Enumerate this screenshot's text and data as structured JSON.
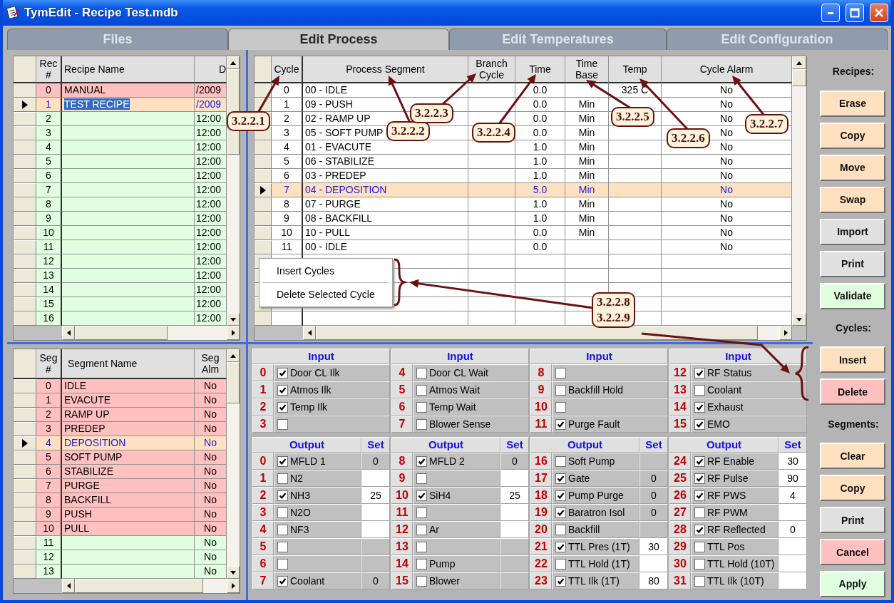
{
  "window": {
    "title": "TymEdit - Recipe Test.mdb"
  },
  "tabs": [
    {
      "label": "Files",
      "selected": false
    },
    {
      "label": "Edit Process",
      "selected": true
    },
    {
      "label": "Edit Temperatures",
      "selected": false
    },
    {
      "label": "Edit Configuration",
      "selected": false
    }
  ],
  "recipes": {
    "columns": [
      "Rec #",
      "Recipe Name",
      "D"
    ],
    "rows": [
      {
        "num": "0",
        "name": "MANUAL",
        "date": "/2009",
        "defined": true,
        "selected": false
      },
      {
        "num": "1",
        "name": "TEST RECIPE",
        "date": "/2009",
        "defined": true,
        "selected": true
      },
      {
        "num": "2",
        "date": "12:00",
        "defined": false,
        "selected": false
      },
      {
        "num": "3",
        "date": "12:00",
        "defined": false,
        "selected": false
      },
      {
        "num": "4",
        "date": "12:00",
        "defined": false,
        "selected": false
      },
      {
        "num": "5",
        "date": "12:00",
        "defined": false,
        "selected": false
      },
      {
        "num": "6",
        "date": "12:00",
        "defined": false,
        "selected": false
      },
      {
        "num": "7",
        "date": "12:00",
        "defined": false,
        "selected": false
      },
      {
        "num": "8",
        "date": "12:00",
        "defined": false,
        "selected": false
      },
      {
        "num": "9",
        "date": "12:00",
        "defined": false,
        "selected": false
      },
      {
        "num": "10",
        "date": "12:00",
        "defined": false,
        "selected": false
      },
      {
        "num": "11",
        "date": "12:00",
        "defined": false,
        "selected": false
      },
      {
        "num": "12",
        "date": "12:00",
        "defined": false,
        "selected": false
      },
      {
        "num": "13",
        "date": "12:00",
        "defined": false,
        "selected": false
      },
      {
        "num": "14",
        "date": "12:00",
        "defined": false,
        "selected": false
      },
      {
        "num": "15",
        "date": "12:00",
        "defined": false,
        "selected": false
      },
      {
        "num": "16",
        "date": "12:00",
        "defined": false,
        "selected": false
      }
    ]
  },
  "cycles": {
    "columns": [
      "Cycle",
      "Process Segment",
      "Branch Cycle",
      "Time",
      "Time Base",
      "Temp",
      "Cycle Alarm"
    ],
    "rows": [
      {
        "cycle": "0",
        "segment": "00 - IDLE",
        "time": "0.0",
        "temp": "325 C",
        "alarm": "No",
        "selected": false
      },
      {
        "cycle": "1",
        "segment": "09 - PUSH",
        "time": "0.0",
        "time_base": "Min",
        "alarm": "No",
        "selected": false
      },
      {
        "cycle": "2",
        "segment": "02 - RAMP UP",
        "time": "0.0",
        "time_base": "Min",
        "alarm": "No",
        "selected": false
      },
      {
        "cycle": "3",
        "segment": "05 - SOFT PUMP",
        "time": "0.0",
        "time_base": "Min",
        "alarm": "No",
        "selected": false
      },
      {
        "cycle": "4",
        "segment": "01 - EVACUTE",
        "time": "1.0",
        "time_base": "Min",
        "alarm": "No",
        "selected": false
      },
      {
        "cycle": "5",
        "segment": "06 - STABILIZE",
        "time": "1.0",
        "time_base": "Min",
        "alarm": "No",
        "selected": false
      },
      {
        "cycle": "6",
        "segment": "03 - PREDEP",
        "time": "1.0",
        "time_base": "Min",
        "alarm": "No",
        "selected": false
      },
      {
        "cycle": "7",
        "segment": "04 - DEPOSITION",
        "time": "5.0",
        "time_base": "Min",
        "alarm": "No",
        "selected": true
      },
      {
        "cycle": "8",
        "segment": "07 - PURGE",
        "time": "1.0",
        "time_base": "Min",
        "alarm": "No",
        "selected": false
      },
      {
        "cycle": "9",
        "segment": "08 - BACKFILL",
        "time": "1.0",
        "time_base": "Min",
        "alarm": "No",
        "selected": false
      },
      {
        "cycle": "10",
        "segment": "10 - PULL",
        "time": "0.0",
        "time_base": "Min",
        "alarm": "No",
        "selected": false
      },
      {
        "cycle": "11",
        "segment": "00 - IDLE",
        "time": "0.0",
        "alarm": "No",
        "selected": false
      }
    ]
  },
  "context_menu": {
    "items": [
      "Insert Cycles",
      "Delete Selected Cycle"
    ]
  },
  "segments": {
    "columns": [
      "Seg #",
      "Segment Name",
      "Seg Alm"
    ],
    "rows": [
      {
        "num": "0",
        "name": "IDLE",
        "alarm": "No",
        "defined": true,
        "selected": false
      },
      {
        "num": "1",
        "name": "EVACUTE",
        "alarm": "No",
        "defined": true,
        "selected": false
      },
      {
        "num": "2",
        "name": "RAMP UP",
        "alarm": "No",
        "defined": true,
        "selected": false
      },
      {
        "num": "3",
        "name": "PREDEP",
        "alarm": "No",
        "defined": true,
        "selected": false
      },
      {
        "num": "4",
        "name": "DEPOSITION",
        "alarm": "No",
        "defined": true,
        "selected": true
      },
      {
        "num": "5",
        "name": "SOFT PUMP",
        "alarm": "No",
        "defined": true,
        "selected": false
      },
      {
        "num": "6",
        "name": "STABILIZE",
        "alarm": "No",
        "defined": true,
        "selected": false
      },
      {
        "num": "7",
        "name": "PURGE",
        "alarm": "No",
        "defined": true,
        "selected": false
      },
      {
        "num": "8",
        "name": "BACKFILL",
        "alarm": "No",
        "defined": true,
        "selected": false
      },
      {
        "num": "9",
        "name": "PUSH",
        "alarm": "No",
        "defined": true,
        "selected": false
      },
      {
        "num": "10",
        "name": "PULL",
        "alarm": "No",
        "defined": true,
        "selected": false
      },
      {
        "num": "11",
        "alarm": "No",
        "defined": false,
        "selected": false
      },
      {
        "num": "12",
        "alarm": "No",
        "defined": false,
        "selected": false
      },
      {
        "num": "13",
        "alarm": "No",
        "defined": false,
        "selected": false
      }
    ]
  },
  "io": {
    "inputs": [
      {
        "header": "Input",
        "items": [
          {
            "num": "0",
            "label": "Door CL Ilk",
            "checked": true
          },
          {
            "num": "1",
            "label": "Atmos Ilk",
            "checked": true
          },
          {
            "num": "2",
            "label": "Temp Ilk",
            "checked": true
          },
          {
            "num": "3",
            "checked": false
          }
        ]
      },
      {
        "header": "Input",
        "items": [
          {
            "num": "4",
            "label": "Door CL Wait",
            "checked": false
          },
          {
            "num": "5",
            "label": "Atmos Wait",
            "checked": false
          },
          {
            "num": "6",
            "label": "Temp Wait",
            "checked": false
          },
          {
            "num": "7",
            "label": "Blower Sense",
            "checked": false
          }
        ]
      },
      {
        "header": "Input",
        "items": [
          {
            "num": "8",
            "checked": false
          },
          {
            "num": "9",
            "label": "Backfill Hold",
            "checked": false
          },
          {
            "num": "10",
            "checked": false
          },
          {
            "num": "11",
            "label": "Purge Fault",
            "checked": true
          }
        ]
      },
      {
        "header": "Input",
        "items": [
          {
            "num": "12",
            "label": "RF Status",
            "checked": true
          },
          {
            "num": "13",
            "label": "Coolant",
            "checked": false
          },
          {
            "num": "14",
            "label": "Exhaust",
            "checked": true
          },
          {
            "num": "15",
            "label": "EMO",
            "checked": true
          }
        ]
      }
    ],
    "outputs": [
      {
        "header": "Output",
        "set_header": "Set",
        "items": [
          {
            "num": "0",
            "label": "MFLD 1",
            "checked": true,
            "set": "0",
            "set_editable": false
          },
          {
            "num": "1",
            "label": "N2",
            "checked": false,
            "set_editable": true
          },
          {
            "num": "2",
            "label": "NH3",
            "checked": true,
            "set": "25",
            "set_editable": true
          },
          {
            "num": "3",
            "label": "N2O",
            "checked": false,
            "set_editable": true
          },
          {
            "num": "4",
            "label": "NF3",
            "checked": false,
            "set_editable": true
          },
          {
            "num": "5",
            "checked": false,
            "set_editable": false
          },
          {
            "num": "6",
            "checked": false,
            "set_editable": false
          },
          {
            "num": "7",
            "label": "Coolant",
            "checked": true,
            "set": "0",
            "set_editable": false
          }
        ]
      },
      {
        "header": "Output",
        "set_header": "Set",
        "items": [
          {
            "num": "8",
            "label": "MFLD 2",
            "checked": true,
            "set": "0",
            "set_editable": false
          },
          {
            "num": "9",
            "checked": false,
            "set_editable": true
          },
          {
            "num": "10",
            "label": "SiH4",
            "checked": true,
            "set": "25",
            "set_editable": true
          },
          {
            "num": "11",
            "checked": false,
            "set_editable": true
          },
          {
            "num": "12",
            "label": "Ar",
            "checked": false,
            "set_editable": true
          },
          {
            "num": "13",
            "checked": false,
            "set_editable": false
          },
          {
            "num": "14",
            "label": "Pump",
            "checked": false,
            "set_editable": false
          },
          {
            "num": "15",
            "label": "Blower",
            "checked": false,
            "set_editable": false
          }
        ]
      },
      {
        "header": "Output",
        "set_header": "Set",
        "items": [
          {
            "num": "16",
            "label": "Soft Pump",
            "checked": false,
            "set_editable": false
          },
          {
            "num": "17",
            "label": "Gate",
            "checked": true,
            "set": "0",
            "set_editable": false
          },
          {
            "num": "18",
            "label": "Pump Purge",
            "checked": true,
            "set": "0",
            "set_editable": false
          },
          {
            "num": "19",
            "label": "Baratron Isol",
            "checked": true,
            "set": "0",
            "set_editable": false
          },
          {
            "num": "20",
            "label": "Backfill",
            "checked": false,
            "set_editable": false
          },
          {
            "num": "21",
            "label": "TTL Pres (1T)",
            "checked": true,
            "set": "30",
            "set_editable": true
          },
          {
            "num": "22",
            "label": "TTL Hold (1T)",
            "checked": false,
            "set_editable": true
          },
          {
            "num": "23",
            "label": "TTL Ilk (1T)",
            "checked": true,
            "set": "80",
            "set_editable": true
          }
        ]
      },
      {
        "header": "Output",
        "set_header": "Set",
        "items": [
          {
            "num": "24",
            "label": "RF Enable",
            "checked": true,
            "set": "30",
            "set_editable": true
          },
          {
            "num": "25",
            "label": "RF Pulse",
            "checked": true,
            "set": "90",
            "set_editable": true
          },
          {
            "num": "26",
            "label": "RF PWS",
            "checked": true,
            "set": "4",
            "set_editable": true
          },
          {
            "num": "27",
            "label": "RF PWM",
            "checked": false,
            "set_editable": true
          },
          {
            "num": "28",
            "label": "RF Reflected",
            "checked": true,
            "set": "0",
            "set_editable": true
          },
          {
            "num": "29",
            "label": "TTL Pos",
            "checked": false,
            "set_editable": true
          },
          {
            "num": "30",
            "label": "TTL Hold (10T)",
            "checked": false,
            "set_editable": true
          },
          {
            "num": "31",
            "label": "TTL Ilk (10T)",
            "checked": false,
            "set_editable": true
          }
        ]
      }
    ]
  },
  "sidebar": [
    {
      "kind": "heading",
      "label": "Recipes:"
    },
    {
      "kind": "button",
      "label": "Erase",
      "color": "#ffe0c0"
    },
    {
      "kind": "button",
      "label": "Copy",
      "color": "#ffe0c0"
    },
    {
      "kind": "button",
      "label": "Move",
      "color": "#ffe0c0"
    },
    {
      "kind": "button",
      "label": "Swap",
      "color": "#ffe0c0"
    },
    {
      "kind": "button",
      "label": "Import",
      "color": "#e0e0e0"
    },
    {
      "kind": "button",
      "label": "Print",
      "color": "#e0e0e0"
    },
    {
      "kind": "button",
      "label": "Validate",
      "color": "#e0ffe0"
    },
    {
      "kind": "heading",
      "label": "Cycles:"
    },
    {
      "kind": "button",
      "label": "Insert",
      "color": "#ffe0c0"
    },
    {
      "kind": "button",
      "label": "Delete",
      "color": "#ffc0c0"
    },
    {
      "kind": "heading",
      "label": "Segments:"
    },
    {
      "kind": "button",
      "label": "Clear",
      "color": "#ffe0c0"
    },
    {
      "kind": "button",
      "label": "Copy",
      "color": "#ffe0c0"
    },
    {
      "kind": "button",
      "label": "Print",
      "color": "#e0e0e0"
    },
    {
      "kind": "button",
      "label": "Cancel",
      "color": "#ffc0c0"
    },
    {
      "kind": "button",
      "label": "Apply",
      "color": "#e0ffe0"
    }
  ],
  "annotations": [
    {
      "lines": [
        "3.2.2.1"
      ]
    },
    {
      "lines": [
        "3.2.2.2"
      ]
    },
    {
      "lines": [
        "3.2.2.3"
      ]
    },
    {
      "lines": [
        "3.2.2.4"
      ]
    },
    {
      "lines": [
        "3.2.2.5"
      ]
    },
    {
      "lines": [
        "3.2.2.6"
      ]
    },
    {
      "lines": [
        "3.2.2.7"
      ]
    },
    {
      "lines": [
        "3.2.2.8",
        "3.2.2.9"
      ]
    }
  ]
}
